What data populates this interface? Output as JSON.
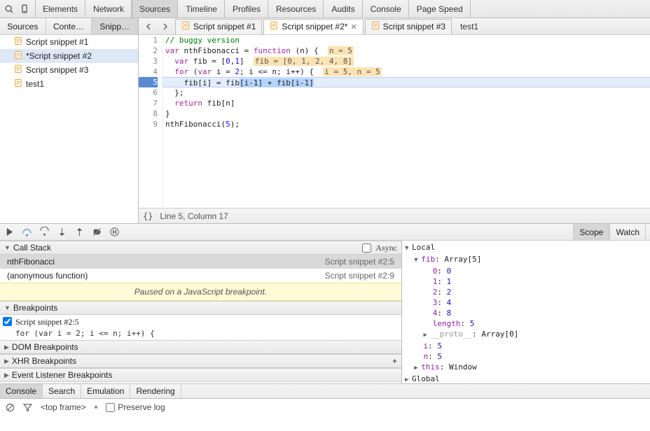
{
  "topbar": {
    "panels": [
      "Elements",
      "Network",
      "Sources",
      "Timeline",
      "Profiles",
      "Resources",
      "Audits",
      "Console",
      "Page Speed"
    ],
    "selected": "Sources"
  },
  "navigator": {
    "tabs": [
      "Sources",
      "Conte…",
      "Snipp…"
    ],
    "selected": 2,
    "items": [
      {
        "label": "Script snippet #1",
        "modified": false
      },
      {
        "label": "*Script snippet #2",
        "modified": true,
        "selected": true
      },
      {
        "label": "Script snippet #3",
        "modified": false
      },
      {
        "label": "test1",
        "modified": false
      }
    ]
  },
  "editor": {
    "tabs": [
      {
        "label": "Script snippet #1",
        "dirty": false
      },
      {
        "label": "Script snippet #2*",
        "dirty": true,
        "selected": true
      },
      {
        "label": "Script snippet #3",
        "dirty": false
      }
    ],
    "extra_tab": "test1",
    "status": "Line 5, Column 17",
    "braces_glyph": "{}",
    "code": {
      "1": "// buggy version",
      "2a": "var",
      "2b": " nthFibonacci = ",
      "2c": "function",
      "2d": " (n) {  ",
      "2anno": "n = 5",
      "3a": "  var",
      "3b": " fib = [",
      "3c": "0",
      "3d": ",",
      "3e": "1",
      "3f": "]  ",
      "3anno": "fib = [0, 1, 2, 4, 8]",
      "4a": "  for",
      "4b": " (",
      "4c": "var",
      "4d": " i = ",
      "4e": "2",
      "4f": "; i <= n; i++) {  ",
      "4anno": "i = 5, n = 5",
      "5a": "    fib[i] = fib",
      "5sel": "[i-1] + fib[i-1]",
      "6": "  };",
      "7a": "  return",
      "7b": " fib[n]",
      "8": "}",
      "9a": "nthFibonacci(",
      "9b": "5",
      "9c": ");"
    }
  },
  "right_tabs": {
    "tabs": [
      "Scope",
      "Watch"
    ],
    "selected": "Scope"
  },
  "callstack": {
    "title": "Call Stack",
    "async_label": "Async",
    "frames": [
      {
        "fn": "nthFibonacci",
        "loc": "Script snippet #2:5",
        "selected": true
      },
      {
        "fn": "(anonymous function)",
        "loc": "Script snippet #2:9"
      }
    ],
    "paused_msg": "Paused on a JavaScript breakpoint."
  },
  "breakpoints": {
    "title": "Breakpoints",
    "items": [
      {
        "label": "Script snippet #2:5",
        "code": "for (var i = 2; i <= n; i++) {",
        "checked": true
      }
    ],
    "sections": [
      "DOM Breakpoints",
      "XHR Breakpoints",
      "Event Listener Breakpoints"
    ]
  },
  "scope": {
    "local_label": "Local",
    "fib_label": "fib",
    "fib_type": "Array[5]",
    "entries": [
      [
        "0",
        "0"
      ],
      [
        "1",
        "1"
      ],
      [
        "2",
        "2"
      ],
      [
        "3",
        "4"
      ],
      [
        "4",
        "8"
      ]
    ],
    "length_label": "length",
    "length_val": "5",
    "proto_label": "__proto__",
    "proto_val": "Array[0]",
    "i_label": "i",
    "i_val": "5",
    "n_label": "n",
    "n_val": "5",
    "this_label": "this",
    "this_val": "Window",
    "global_label": "Global"
  },
  "console_tabs": {
    "tabs": [
      "Console",
      "Search",
      "Emulation",
      "Rendering"
    ],
    "selected": "Console"
  },
  "console_bar": {
    "frame": "<top frame>",
    "frame_arrow": "▾",
    "preserve_label": "Preserve log"
  }
}
